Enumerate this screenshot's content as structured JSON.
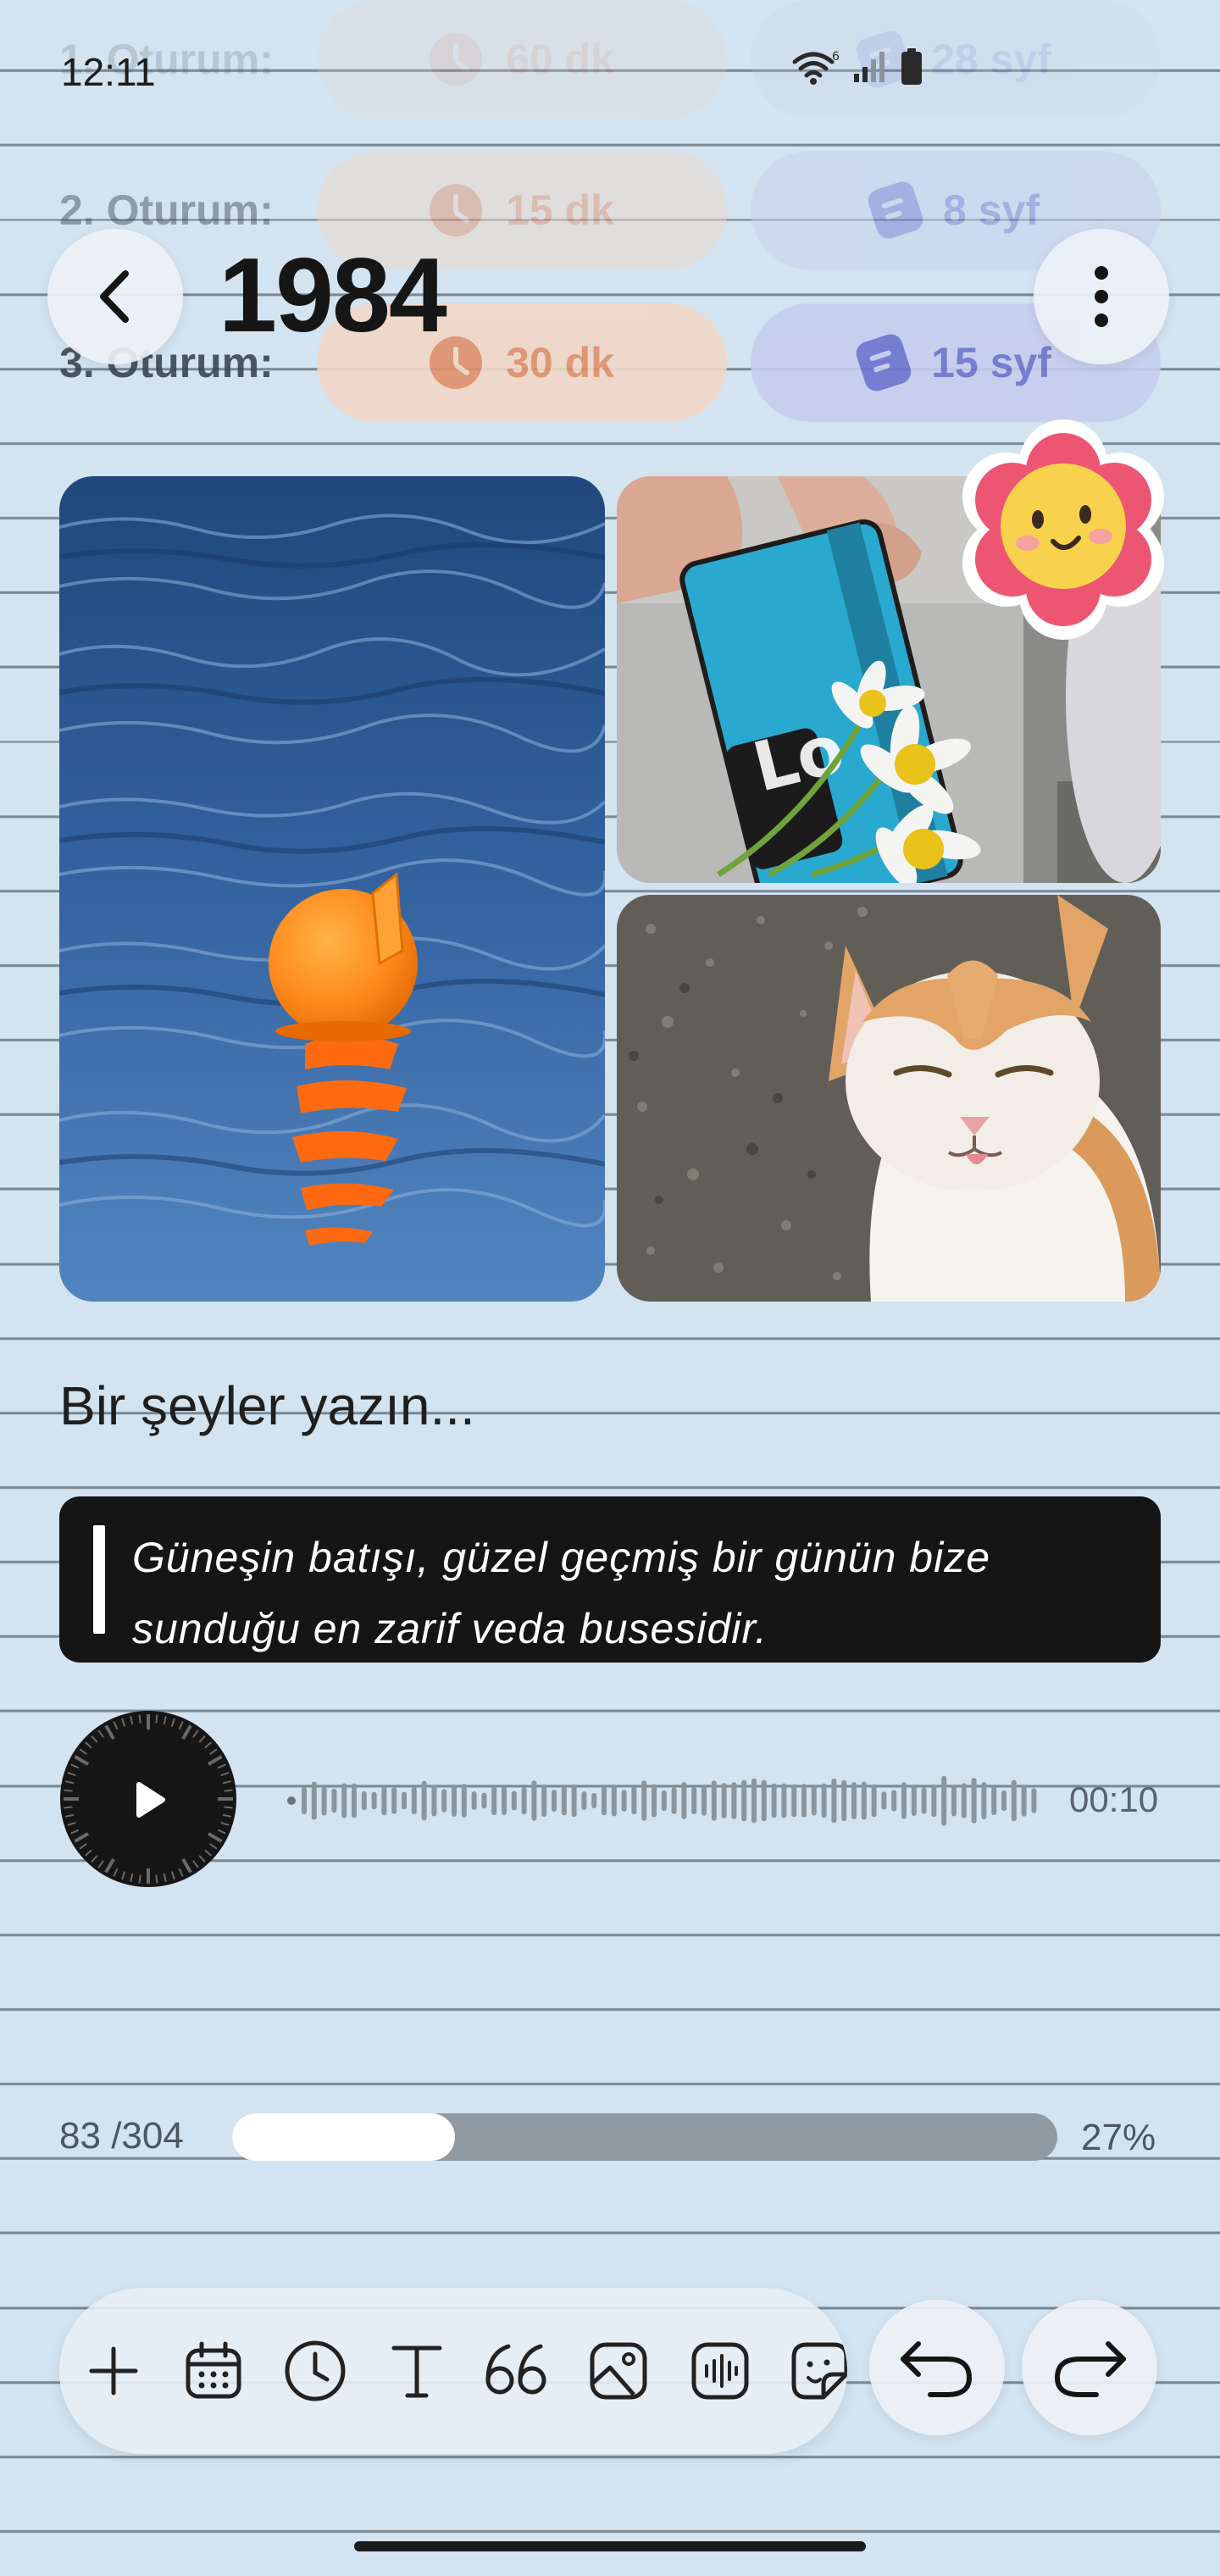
{
  "status_bar": {
    "time": "12:11"
  },
  "sessions": [
    {
      "label": "1. Oturum:",
      "time": "60 dk",
      "pages": "28 syf"
    },
    {
      "label": "2. Oturum:",
      "time": "15 dk",
      "pages": "8 syf"
    },
    {
      "label": "3. Oturum:",
      "time": "30 dk",
      "pages": "15 syf"
    }
  ],
  "header": {
    "title": "1984",
    "back_icon": "chevron-left-icon",
    "menu_icon": "more-vertical-icon"
  },
  "editor": {
    "placeholder": "Bir şeyler yazın...",
    "quote": "Güneşin batışı, güzel geçmiş bir günün bize sunduğu en zarif veda busesidir."
  },
  "audio": {
    "duration": "00:10"
  },
  "progress": {
    "current": "83",
    "total": "/304",
    "percent": "27%",
    "fraction": 0.27
  },
  "toolbar": {
    "tools": [
      "add-icon",
      "calendar-icon",
      "clock-icon",
      "text-icon",
      "quote-icon",
      "image-icon",
      "audio-icon",
      "sticker-icon"
    ]
  },
  "colors": {
    "background": "#d3e3ef",
    "time_pill": "#f1d7c8",
    "time_accent": "#e1906b",
    "page_pill": "#c7cdee",
    "page_accent": "#6d74cf"
  }
}
